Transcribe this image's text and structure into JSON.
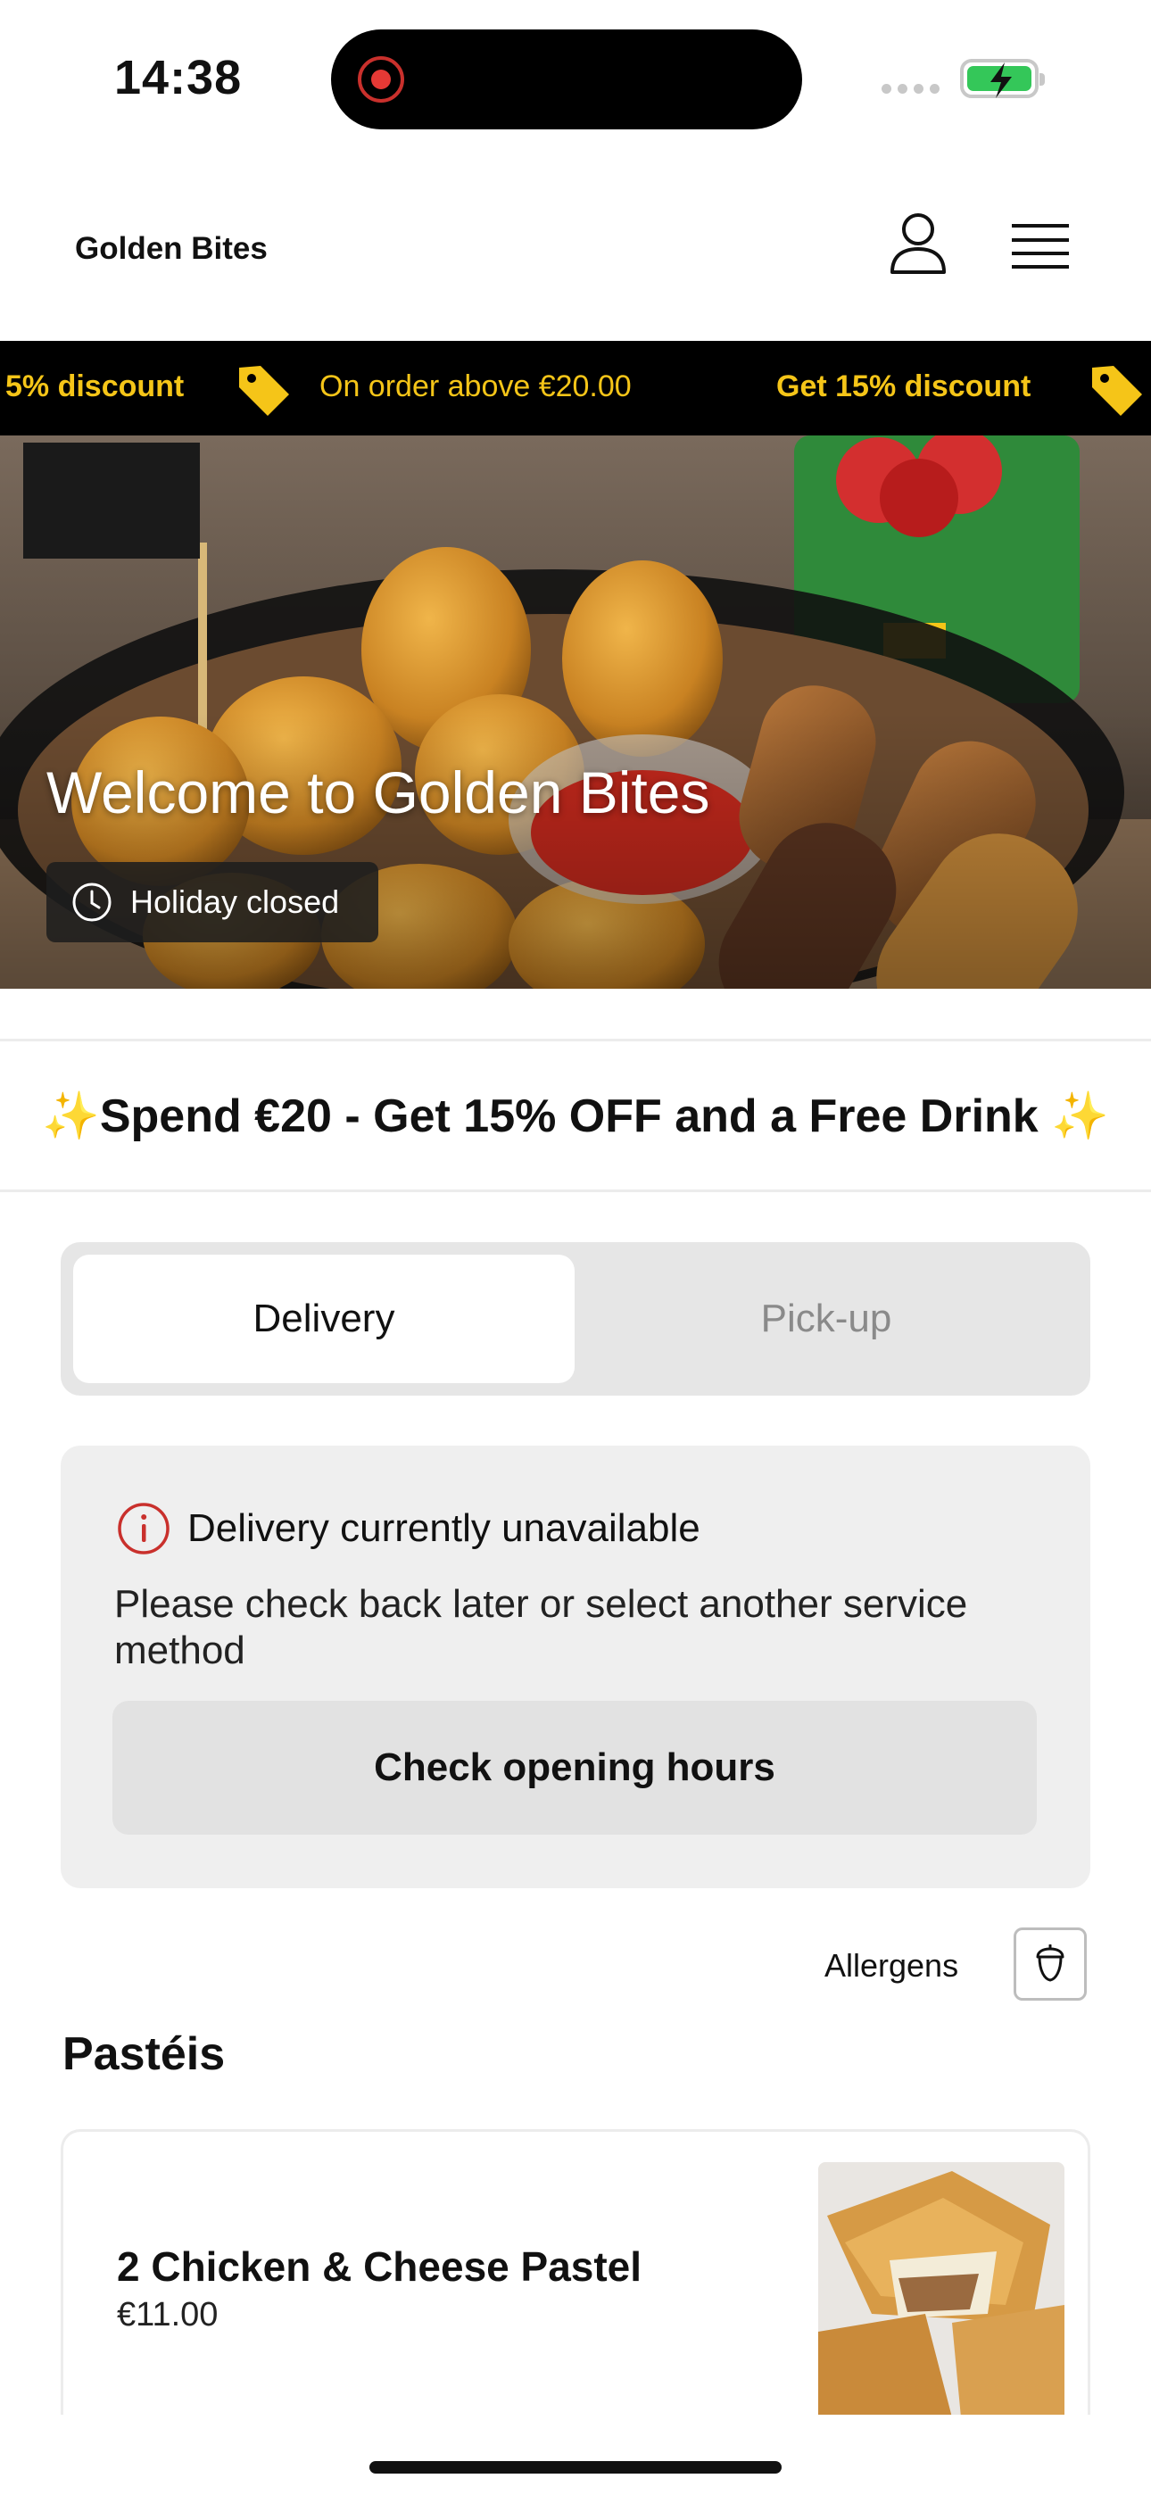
{
  "status_bar": {
    "time": "14:38"
  },
  "header": {
    "brand": "Golden Bites"
  },
  "ticker": {
    "items": [
      "5% discount",
      "On order above €20.00",
      "Get 15% discount"
    ]
  },
  "hero": {
    "title": "Welcome to Golden Bites",
    "status": "Holiday closed"
  },
  "promo": {
    "text": "✨Spend €20 - Get 15% OFF and a Free Drink ✨"
  },
  "service_toggle": {
    "options": [
      "Delivery",
      "Pick-up"
    ],
    "selected": "Delivery"
  },
  "unavailable": {
    "title": "Delivery currently unavailable",
    "description": "Please check back later or select another service method",
    "button": "Check opening hours"
  },
  "allergens": {
    "label": "Allergens"
  },
  "menu": {
    "section_title": "Pastéis",
    "items": [
      {
        "name": "2 Chicken & Cheese Pastel",
        "price": "€11.00"
      }
    ]
  },
  "colors": {
    "accent": "#f5c518",
    "warning": "#c9302c",
    "battery": "#34c759"
  }
}
